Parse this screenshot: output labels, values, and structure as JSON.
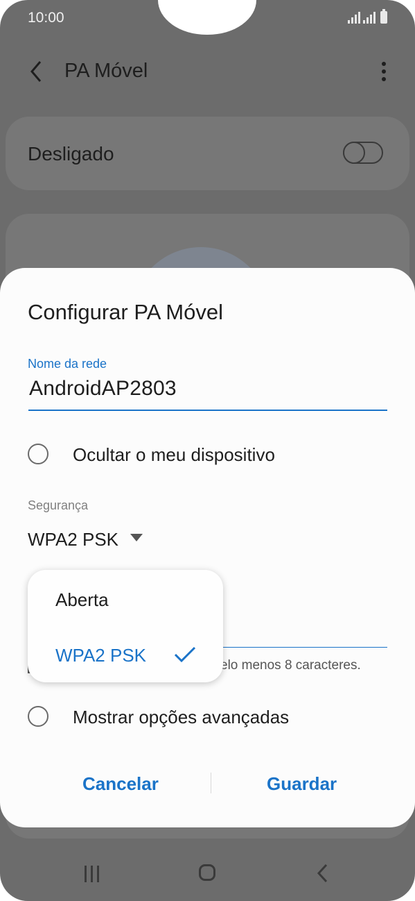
{
  "status_bar": {
    "time": "10:00"
  },
  "app_bar": {
    "title": "PA Móvel"
  },
  "hotspot_toggle": {
    "label": "Desligado",
    "state": "off"
  },
  "dialog": {
    "title": "Configurar PA Móvel",
    "network_name": {
      "label": "Nome da rede",
      "value": "AndroidAP2803"
    },
    "hide_device": {
      "label": "Ocultar o meu dispositivo",
      "checked": false
    },
    "security": {
      "label": "Segurança",
      "value": "WPA2 PSK"
    },
    "password_hint": "elo menos 8 caracteres.",
    "advanced": {
      "label": "Mostrar opções avançadas",
      "checked": false
    },
    "cancel_label": "Cancelar",
    "save_label": "Guardar"
  },
  "security_menu": {
    "options": [
      {
        "label": "Aberta",
        "selected": false
      },
      {
        "label": "WPA2 PSK",
        "selected": true
      }
    ]
  },
  "colors": {
    "accent": "#1a73c8",
    "dim_background": "#6c6c6c",
    "dialog": "#fcfcfc"
  },
  "icons": [
    "back-icon",
    "more-options-icon",
    "check-icon",
    "recent-apps-icon",
    "home-icon",
    "nav-back-icon"
  ]
}
